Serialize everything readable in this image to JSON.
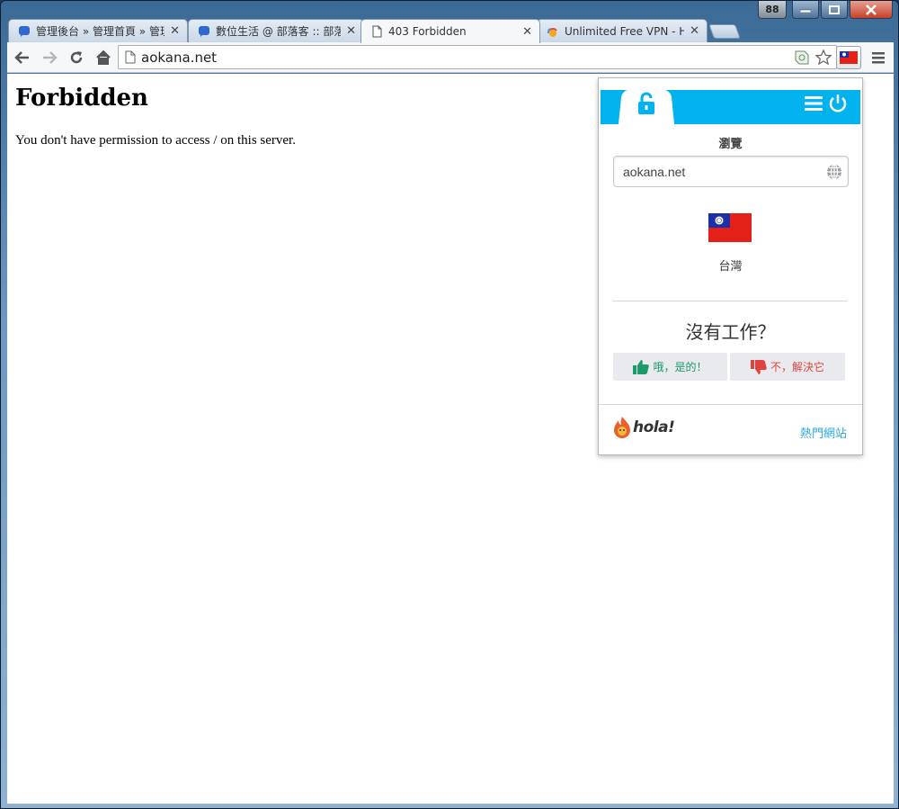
{
  "window": {
    "count_badge": "88",
    "minimize_label": "▁",
    "maximize_label": "□",
    "close_label": "✕"
  },
  "tabs": [
    {
      "title": "管理後台 » 管理首頁 » 管理",
      "active": false,
      "favicon": "blogger-icon"
    },
    {
      "title": "數位生活 @ 部落客 :: 部落",
      "active": false,
      "favicon": "blogger-icon"
    },
    {
      "title": "403 Forbidden",
      "active": true,
      "favicon": "page-icon"
    },
    {
      "title": "Unlimited Free VPN - Ho",
      "active": false,
      "favicon": "hola-icon"
    }
  ],
  "toolbar": {
    "url": "aokana.net"
  },
  "page": {
    "heading": "Forbidden",
    "message": "You don't have permission to access / on this server."
  },
  "hola": {
    "browse_label": "瀏覽",
    "site_value": "aokana.net",
    "country": "台灣",
    "not_working": "沒有工作？",
    "yes_label": "哦，是的！",
    "no_label": "不，解決它",
    "brand": "hola!",
    "popular_sites": "熱門網站",
    "accent_color": "#00b3ef"
  }
}
